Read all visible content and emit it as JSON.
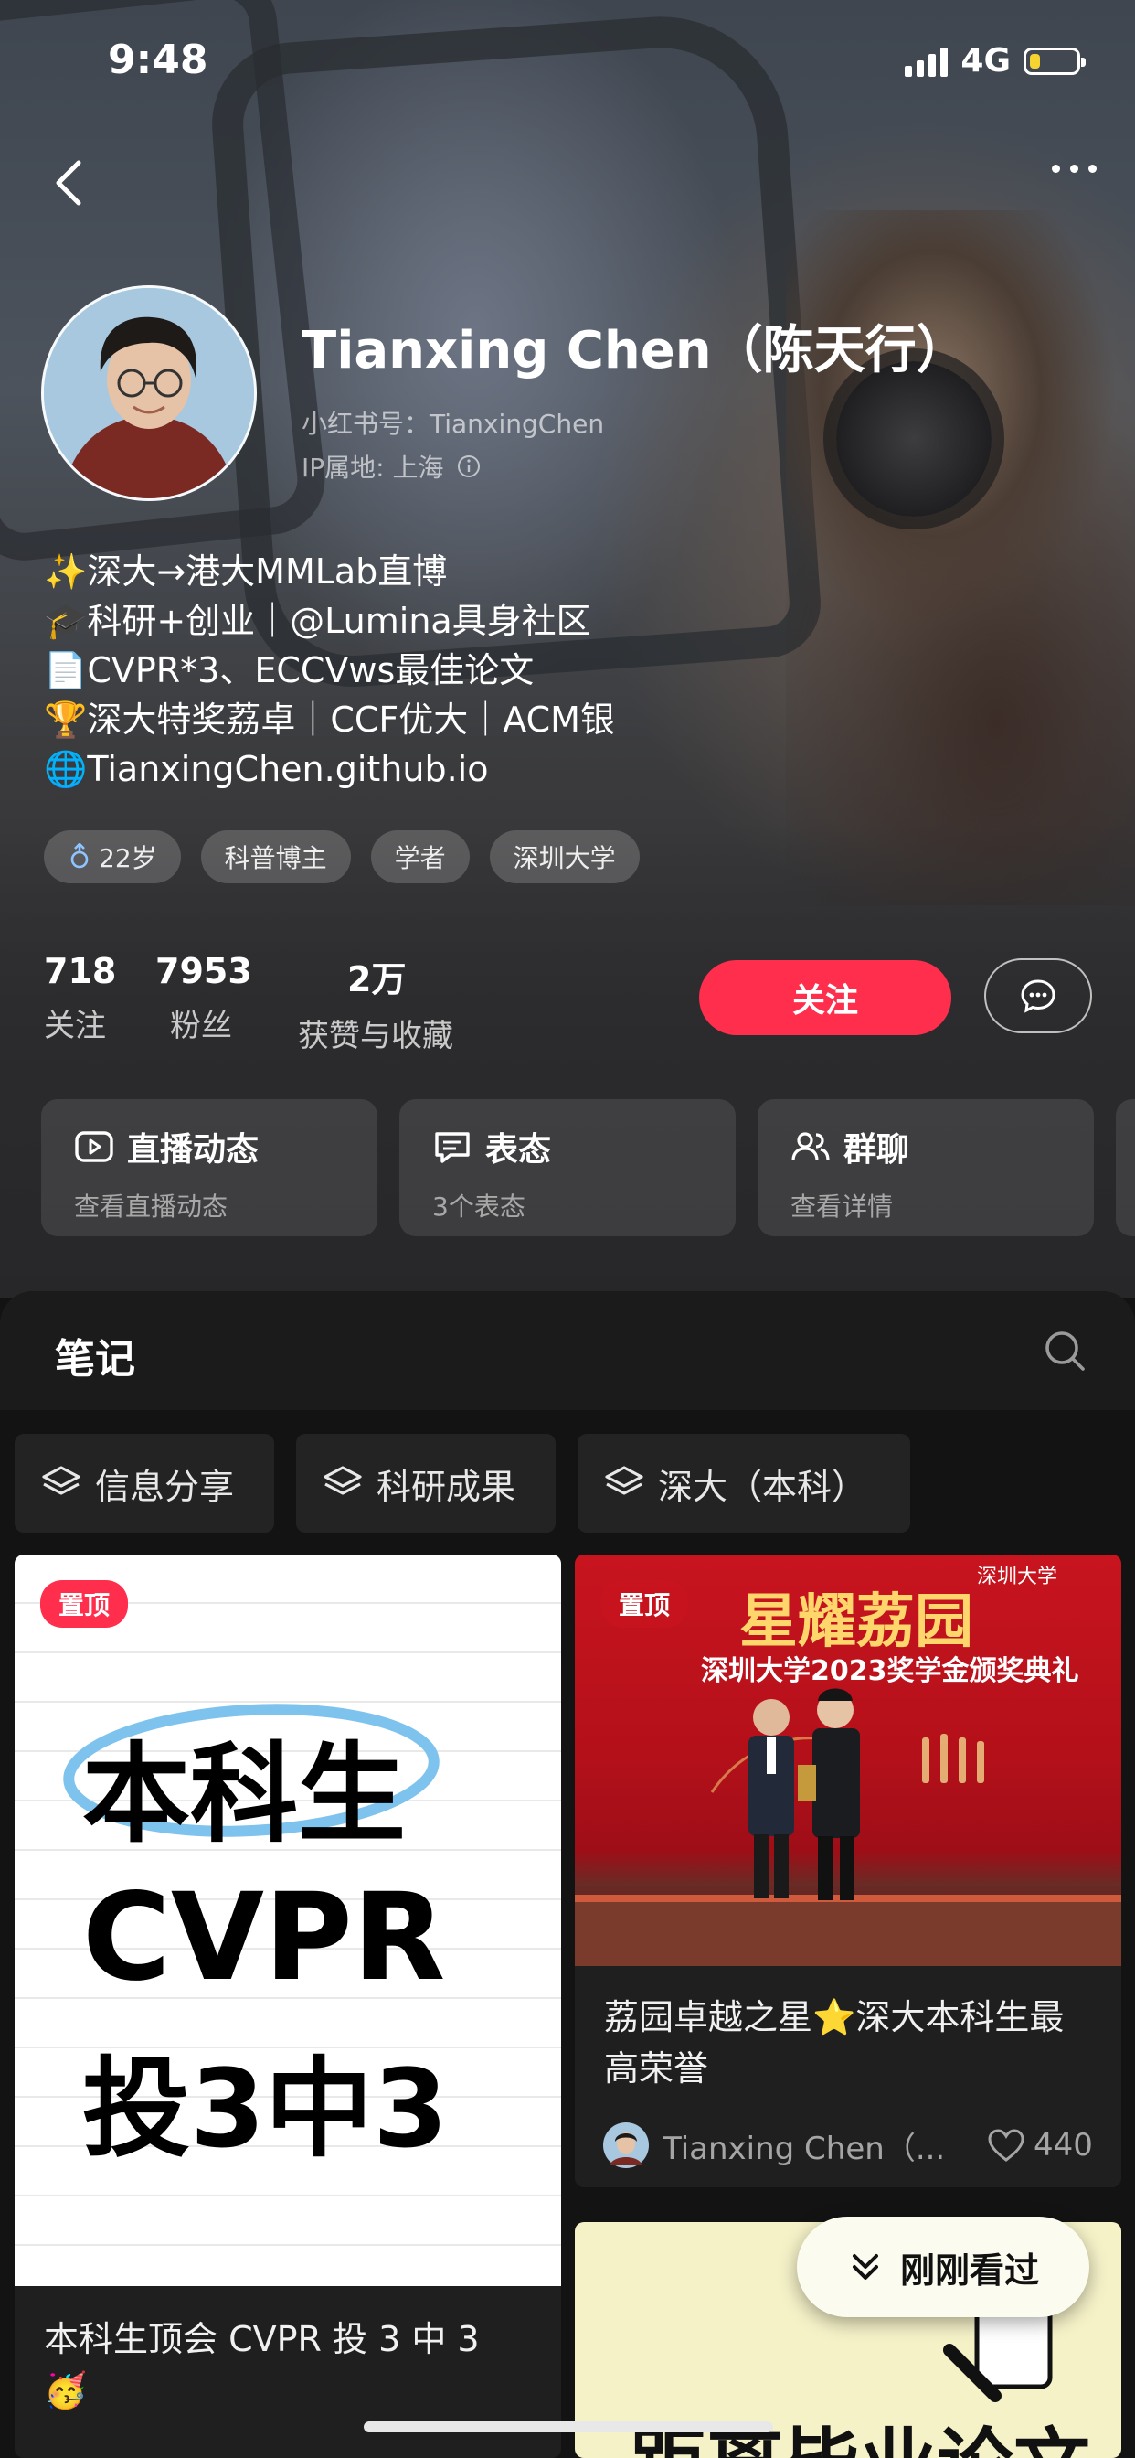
{
  "status_bar": {
    "time": "9:48",
    "network": "4G",
    "battery_level": 0.22
  },
  "profile": {
    "name": "Tianxing Chen（陈天行）",
    "xhs_id": "小红书号：TianxingChen",
    "ip_location": "IP属地: 上海",
    "bio": [
      "✨深大→港大MMLab直博",
      "🎓科研+创业｜@Lumina具身社区",
      "📄CVPR*3、ECCVws最佳论文",
      "🏆深大特奖荔卓｜CCF优大｜ACM银",
      "🌐TianxingChen.github.io"
    ],
    "tags": [
      "22岁",
      "科普博主",
      "学者",
      "深圳大学"
    ]
  },
  "stats": [
    {
      "value": "718",
      "label": "关注"
    },
    {
      "value": "7953",
      "label": "粉丝"
    },
    {
      "value": "2万",
      "label": "获赞与收藏"
    }
  ],
  "actions": {
    "follow": "关注"
  },
  "feature_cards": [
    {
      "title": "直播动态",
      "subtitle": "查看直播动态",
      "icon": "live-icon"
    },
    {
      "title": "表态",
      "subtitle": "3个表态",
      "icon": "comment-icon"
    },
    {
      "title": "群聊",
      "subtitle": "查看详情",
      "icon": "group-icon"
    }
  ],
  "notes": {
    "tab": "笔记",
    "filters": [
      "信息分享",
      "科研成果",
      "深大（本科）"
    ],
    "items": [
      {
        "pinned": "置顶",
        "cover_lines": [
          "本科生",
          "CVPR",
          "投3中3"
        ],
        "title": "本科生顶会 CVPR 投 3 中 3",
        "title_emoji": "🥳"
      },
      {
        "pinned": "置顶",
        "cover_banner": "星耀荔园",
        "cover_subtitle": "深圳大学2023奖学金颁奖典礼",
        "cover_logo": "深圳大学",
        "title": "荔园卓越之星⭐深大本科生最高荣誉",
        "author": "Tianxing Chen（...",
        "likes": "440"
      },
      {
        "cover_text": "距离毕业论文"
      }
    ]
  },
  "recent_pill": "刚刚看过",
  "colors": {
    "accent": "#ff2e4d",
    "battery": "#f5d431"
  }
}
